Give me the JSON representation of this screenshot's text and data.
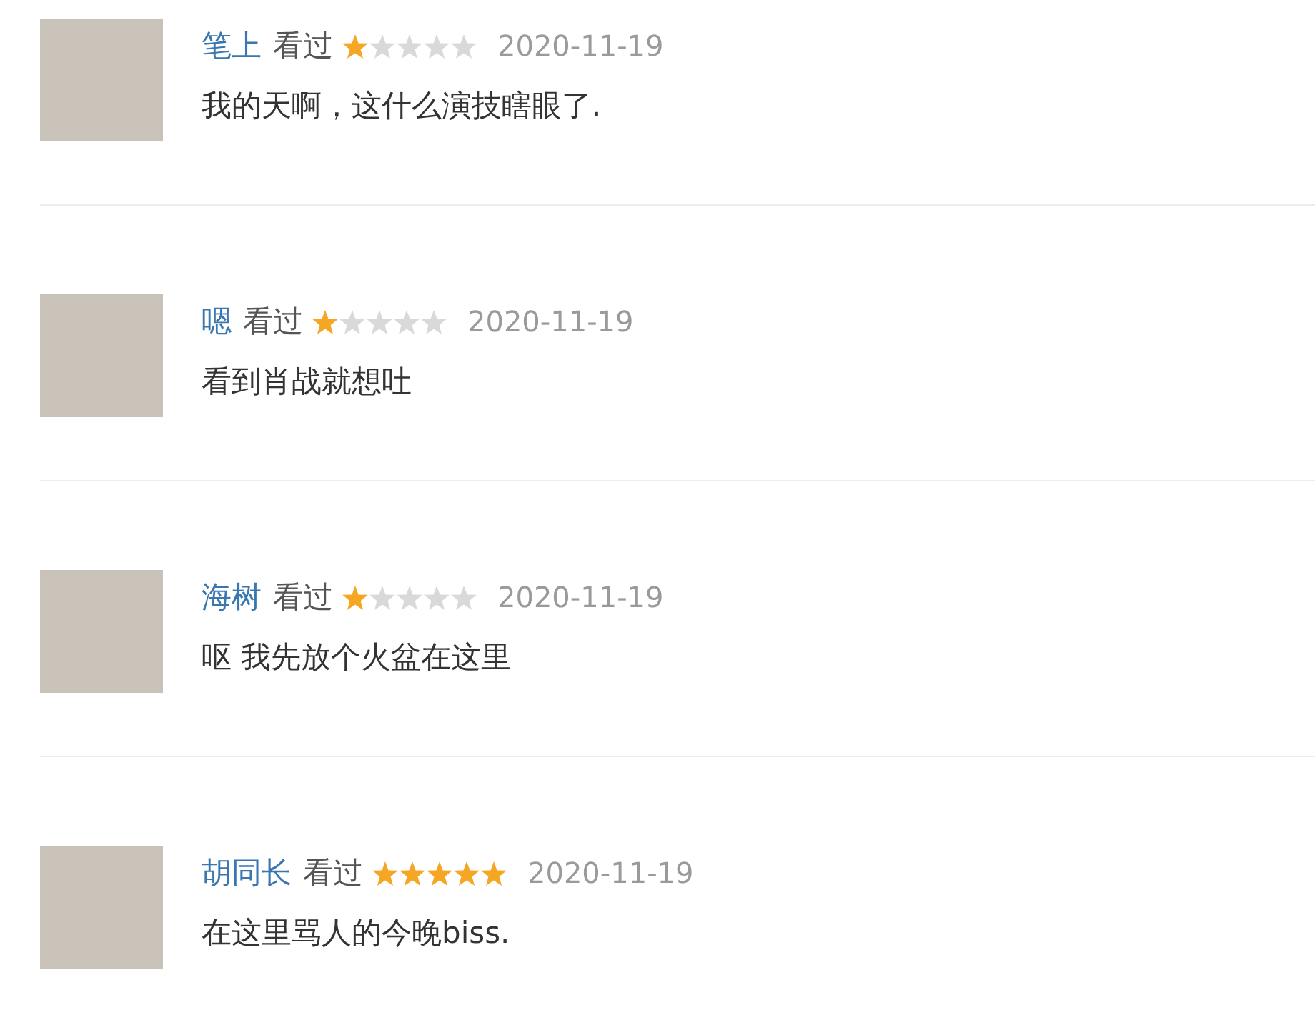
{
  "comments": [
    {
      "user": "笔上",
      "status": "看过",
      "stars": 1,
      "date": "2020-11-19",
      "text": "我的天啊，这什么演技瞎眼了."
    },
    {
      "user": "嗯",
      "status": "看过",
      "stars": 1,
      "date": "2020-11-19",
      "text": "看到肖战就想吐"
    },
    {
      "user": "海树",
      "status": "看过",
      "stars": 1,
      "date": "2020-11-19",
      "text": "呕 我先放个火盆在这里"
    },
    {
      "user": "胡同长",
      "status": "看过",
      "stars": 5,
      "date": "2020-11-19",
      "text": "在这里骂人的今晚biss."
    }
  ]
}
